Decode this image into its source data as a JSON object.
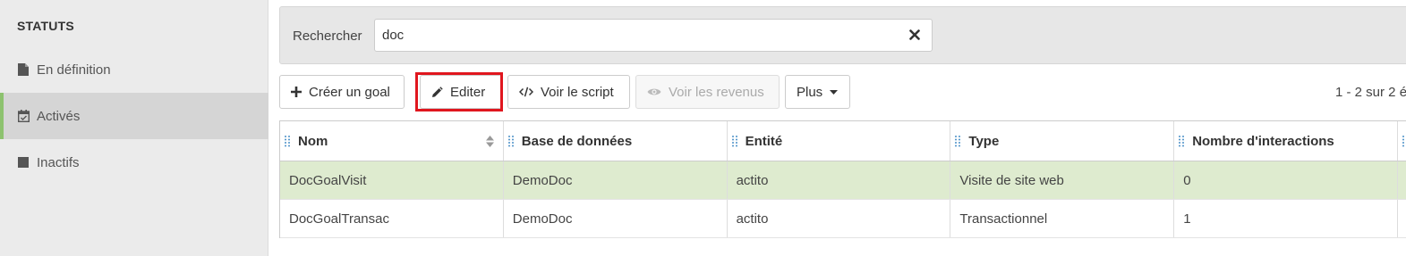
{
  "sidebar": {
    "title": "STATUTS",
    "items": [
      {
        "label": "En définition",
        "icon": "file-icon"
      },
      {
        "label": "Activés",
        "icon": "calendar-check-icon"
      },
      {
        "label": "Inactifs",
        "icon": "square-icon"
      }
    ],
    "accent_color": "#8dc26f"
  },
  "search": {
    "label": "Rechercher",
    "value": "doc"
  },
  "toolbar": {
    "create_label": "Créer un goal",
    "edit_label": "Editer",
    "script_label": "Voir le script",
    "revenue_label": "Voir les revenus",
    "more_label": "Plus",
    "pager_text": "1 - 2 sur 2 é",
    "highlight_color": "#e0161e"
  },
  "table": {
    "columns": [
      "Nom",
      "Base de données",
      "Entité",
      "Type",
      "Nombre d'interactions"
    ],
    "rows": [
      {
        "nom": "DocGoalVisit",
        "base": "DemoDoc",
        "entite": "actito",
        "type": "Visite de site web",
        "interactions": "0"
      },
      {
        "nom": "DocGoalTransac",
        "base": "DemoDoc",
        "entite": "actito",
        "type": "Transactionnel",
        "interactions": "1"
      }
    ],
    "selected_row_color": "#deebcf"
  }
}
